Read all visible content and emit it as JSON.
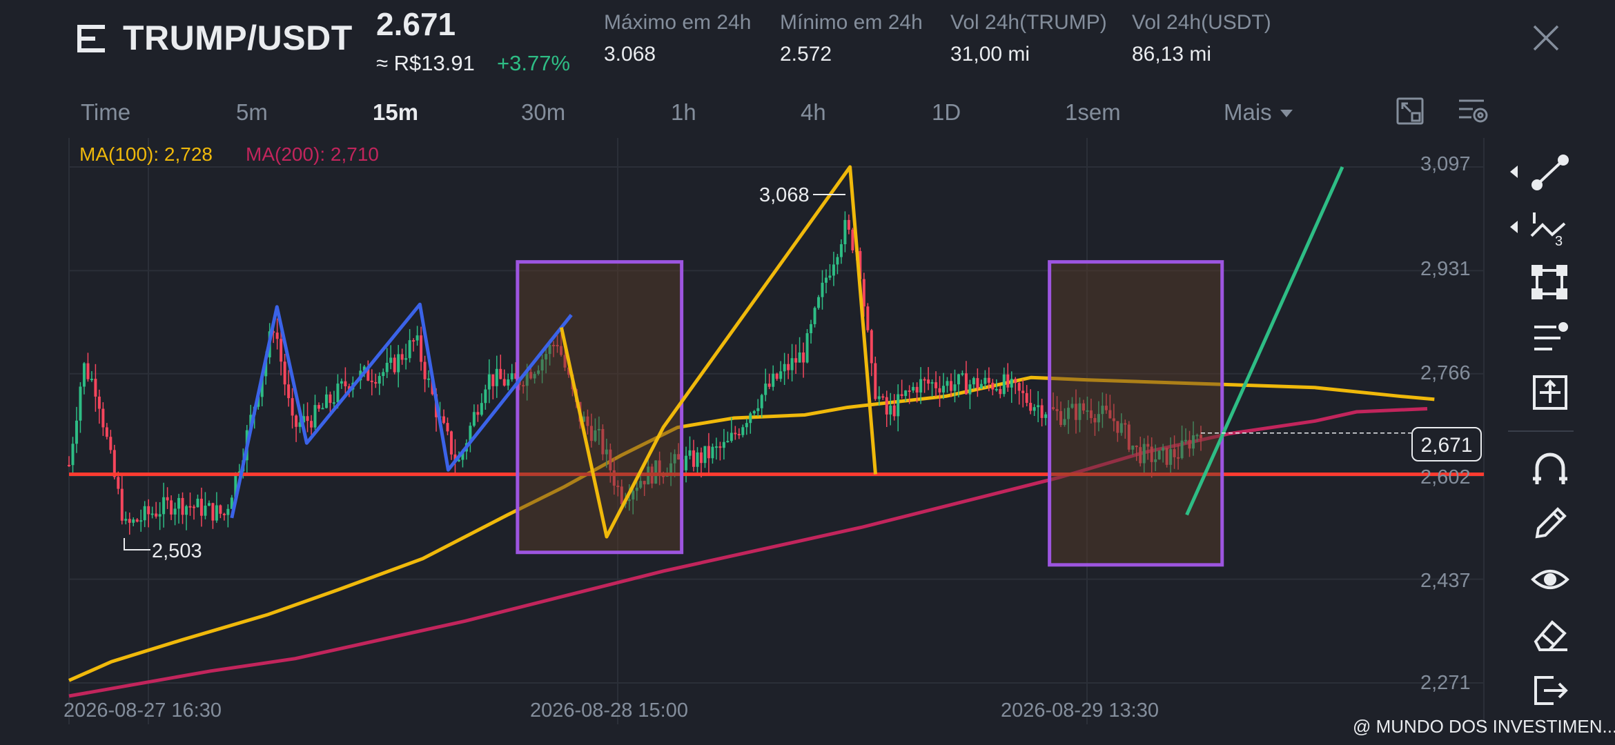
{
  "header": {
    "pair": "TRUMP/USDT",
    "last_price": "2.671",
    "fiat_price": "≈ R$13.91",
    "change": "+3.77%",
    "stats": [
      {
        "label": "Máximo em 24h",
        "value": "3.068"
      },
      {
        "label": "Mínimo em 24h",
        "value": "2.572"
      },
      {
        "label": "Vol 24h(TRUMP)",
        "value": "31,00 mi"
      },
      {
        "label": "Vol 24h(USDT)",
        "value": "86,13 mi"
      }
    ]
  },
  "timeframes": {
    "items": [
      "Time",
      "5m",
      "15m",
      "30m",
      "1h",
      "4h",
      "1D",
      "1sem",
      "Mais"
    ],
    "active": "15m"
  },
  "indicators": {
    "ma100": "MA(100): 2,728",
    "ma200": "MA(200): 2,710"
  },
  "chart_data": {
    "type": "candlestick",
    "pair": "TRUMP/USDT",
    "interval": "15m",
    "y_axis_ticks": [
      "3,097",
      "2,931",
      "2,766",
      "2,602",
      "2,437",
      "2,271"
    ],
    "x_axis_ticks": [
      "2026-08-27 16:30",
      "2026-08-28 15:00",
      "2026-08-29 13:30"
    ],
    "ylim": [
      2.25,
      3.12
    ],
    "current_price_label": "2,671",
    "current_price": 2.671,
    "annotations": {
      "high_label": "3,068",
      "high": 3.068,
      "low_label": "2,503",
      "low": 2.503
    },
    "horizontal_line": {
      "price": 2.605,
      "color": "#ff3b30"
    },
    "colors": {
      "up": "#2ebd85",
      "down": "#f6465d",
      "ma100": "#f0b90b",
      "ma200": "#c2255c",
      "drawing_blue": "#3b63e8",
      "drawing_yellow": "#f0b90b",
      "drawing_green": "#2ebd85",
      "box_border": "#9d55e0"
    },
    "ma100_path": [
      [
        0.0,
        2.275
      ],
      [
        0.03,
        2.305
      ],
      [
        0.08,
        2.34
      ],
      [
        0.14,
        2.38
      ],
      [
        0.19,
        2.42
      ],
      [
        0.25,
        2.47
      ],
      [
        0.31,
        2.54
      ],
      [
        0.35,
        2.585
      ],
      [
        0.39,
        2.635
      ],
      [
        0.43,
        2.68
      ],
      [
        0.47,
        2.695
      ],
      [
        0.52,
        2.7
      ],
      [
        0.55,
        2.712
      ],
      [
        0.62,
        2.73
      ],
      [
        0.68,
        2.76
      ],
      [
        0.72,
        2.756
      ],
      [
        0.8,
        2.75
      ],
      [
        0.88,
        2.744
      ],
      [
        0.94,
        2.73
      ],
      [
        0.965,
        2.725
      ]
    ],
    "ma200_path": [
      [
        0.0,
        2.25
      ],
      [
        0.1,
        2.29
      ],
      [
        0.16,
        2.31
      ],
      [
        0.22,
        2.34
      ],
      [
        0.28,
        2.37
      ],
      [
        0.35,
        2.41
      ],
      [
        0.42,
        2.45
      ],
      [
        0.48,
        2.48
      ],
      [
        0.56,
        2.52
      ],
      [
        0.63,
        2.56
      ],
      [
        0.7,
        2.6
      ],
      [
        0.76,
        2.64
      ],
      [
        0.82,
        2.67
      ],
      [
        0.88,
        2.69
      ],
      [
        0.91,
        2.705
      ],
      [
        0.96,
        2.71
      ]
    ],
    "drawings": [
      {
        "color": "#3b63e8",
        "points": [
          [
            0.115,
            2.535
          ],
          [
            0.147,
            2.873
          ],
          [
            0.168,
            2.655
          ],
          [
            0.248,
            2.877
          ],
          [
            0.268,
            2.612
          ],
          [
            0.355,
            2.86
          ]
        ]
      },
      {
        "color": "#f0b90b",
        "points": [
          [
            0.348,
            2.84
          ],
          [
            0.38,
            2.505
          ],
          [
            0.42,
            2.68
          ],
          [
            0.552,
            3.097
          ],
          [
            0.57,
            2.605
          ]
        ]
      },
      {
        "color": "#2ebd85",
        "points": [
          [
            0.79,
            2.54
          ],
          [
            0.9,
            3.097
          ]
        ]
      }
    ],
    "boxes": [
      {
        "x0": 0.317,
        "x1": 0.433,
        "y0": 2.48,
        "y1": 2.945
      },
      {
        "x0": 0.693,
        "x1": 0.815,
        "y0": 2.46,
        "y1": 2.945
      }
    ]
  },
  "watermark": "@ MUNDO DOS INVESTIMEN...",
  "toolbar": [
    "trend-line-icon",
    "fibonacci-icon",
    "shape-icon",
    "text-tool-icon",
    "measure-icon",
    "magnet-icon",
    "pencil-icon",
    "eye-icon",
    "eraser-icon",
    "exit-icon"
  ]
}
